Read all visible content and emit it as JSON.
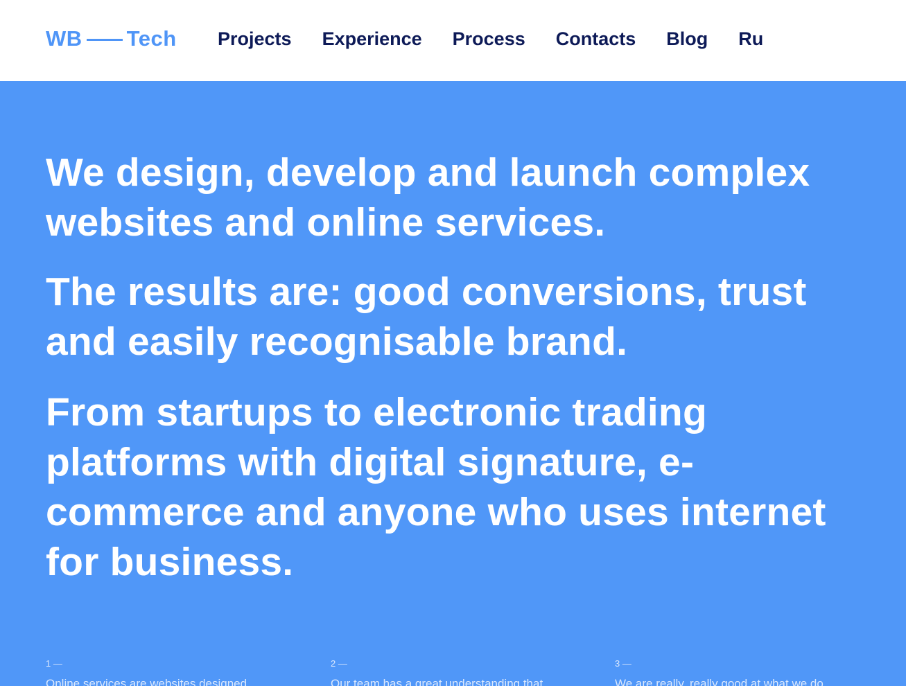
{
  "header": {
    "logo": {
      "left": "WB",
      "right": "Tech"
    },
    "nav": [
      "Projects",
      "Experience",
      "Process",
      "Contacts",
      "Blog",
      "Ru"
    ]
  },
  "hero": {
    "statements": [
      "We design, develop and launch complex websites and online services.",
      "The results are: good conversions, trust and easily recognisable brand.",
      "From startups to electronic trading platforms with digital signature, e-commerce and anyone who uses internet for business."
    ],
    "features": [
      {
        "number": "1 —",
        "text": "Online services are websites designed"
      },
      {
        "number": "2 —",
        "text": "Our team has a great understanding that"
      },
      {
        "number": "3 —",
        "text": "We are really, really good at what we do"
      }
    ]
  },
  "colors": {
    "brand_blue": "#4f95f7",
    "hero_background": "#5097f8",
    "nav_text": "#0d1a57",
    "hero_text": "#ffffff"
  }
}
